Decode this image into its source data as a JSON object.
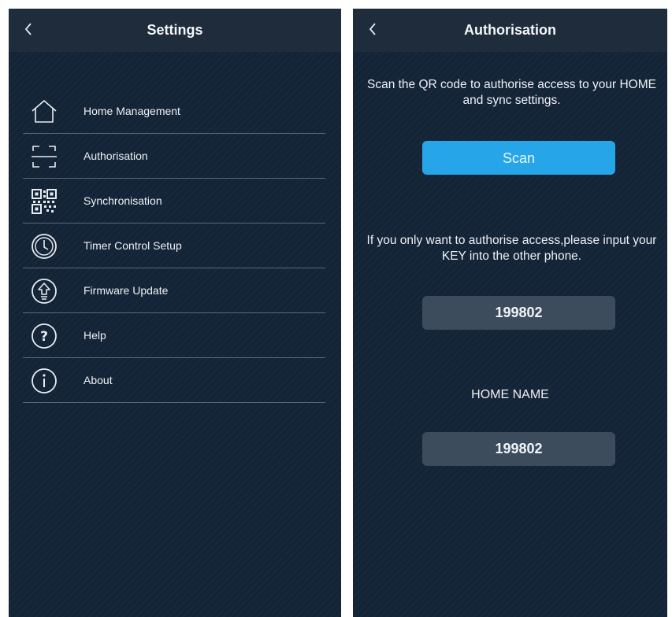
{
  "settings_screen": {
    "title": "Settings",
    "back_icon": "chevron-left-icon",
    "menu": [
      {
        "label": "Home Management",
        "icon": "home-icon"
      },
      {
        "label": "Authorisation",
        "icon": "scan-frame-icon"
      },
      {
        "label": "Synchronisation",
        "icon": "qr-code-icon"
      },
      {
        "label": "Timer Control Setup",
        "icon": "clock-icon"
      },
      {
        "label": "Firmware Update",
        "icon": "firmware-update-icon"
      },
      {
        "label": "Help",
        "icon": "help-icon"
      },
      {
        "label": "About",
        "icon": "info-icon"
      }
    ]
  },
  "authorisation_screen": {
    "title": "Authorisation",
    "back_icon": "chevron-left-icon",
    "scan_instruction": "Scan the QR code to authorise access to your HOME and sync settings.",
    "scan_button_label": "Scan",
    "key_instruction": "If you only want to authorise access,please input your KEY into the other phone.",
    "key_value": "199802",
    "home_name_label": "HOME NAME",
    "home_name_value": "199802"
  },
  "colors": {
    "background": "#142437",
    "topbar": "#1e2c3c",
    "scan_button": "#26a6e9",
    "value_box": "#3c4c5d",
    "divider": "#5c6877"
  }
}
